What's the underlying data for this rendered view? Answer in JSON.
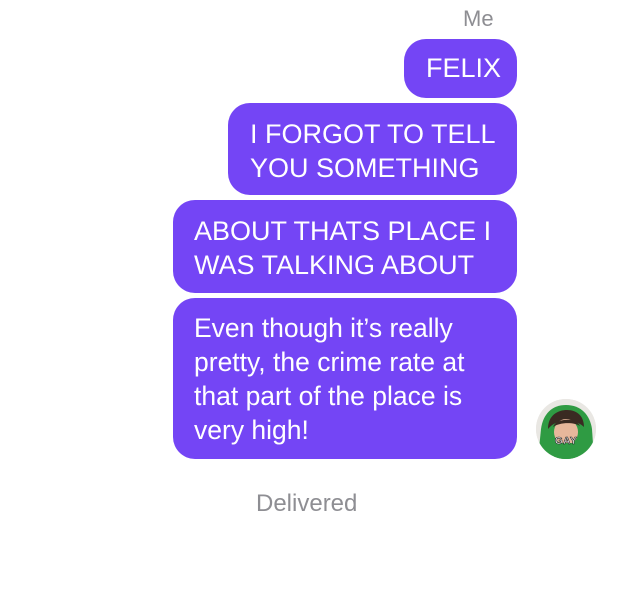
{
  "conversation": {
    "sender_label": "Me",
    "messages": [
      {
        "lines": [
          "FELIX"
        ]
      },
      {
        "lines": [
          "I FORGOT TO TELL",
          "YOU SOMETHING"
        ]
      },
      {
        "lines": [
          "ABOUT THATS PLACE I",
          "WAS TALKING ABOUT"
        ]
      },
      {
        "lines": [
          "Even though it’s really",
          "pretty, the crime rate at",
          "that part of the place is",
          "very high!"
        ]
      }
    ],
    "avatar": {
      "caption": "GAY"
    },
    "status": "Delivered"
  },
  "colors": {
    "bubble": "#7445f5",
    "bubble_text": "#ffffff",
    "meta_text": "#8e8e93"
  }
}
